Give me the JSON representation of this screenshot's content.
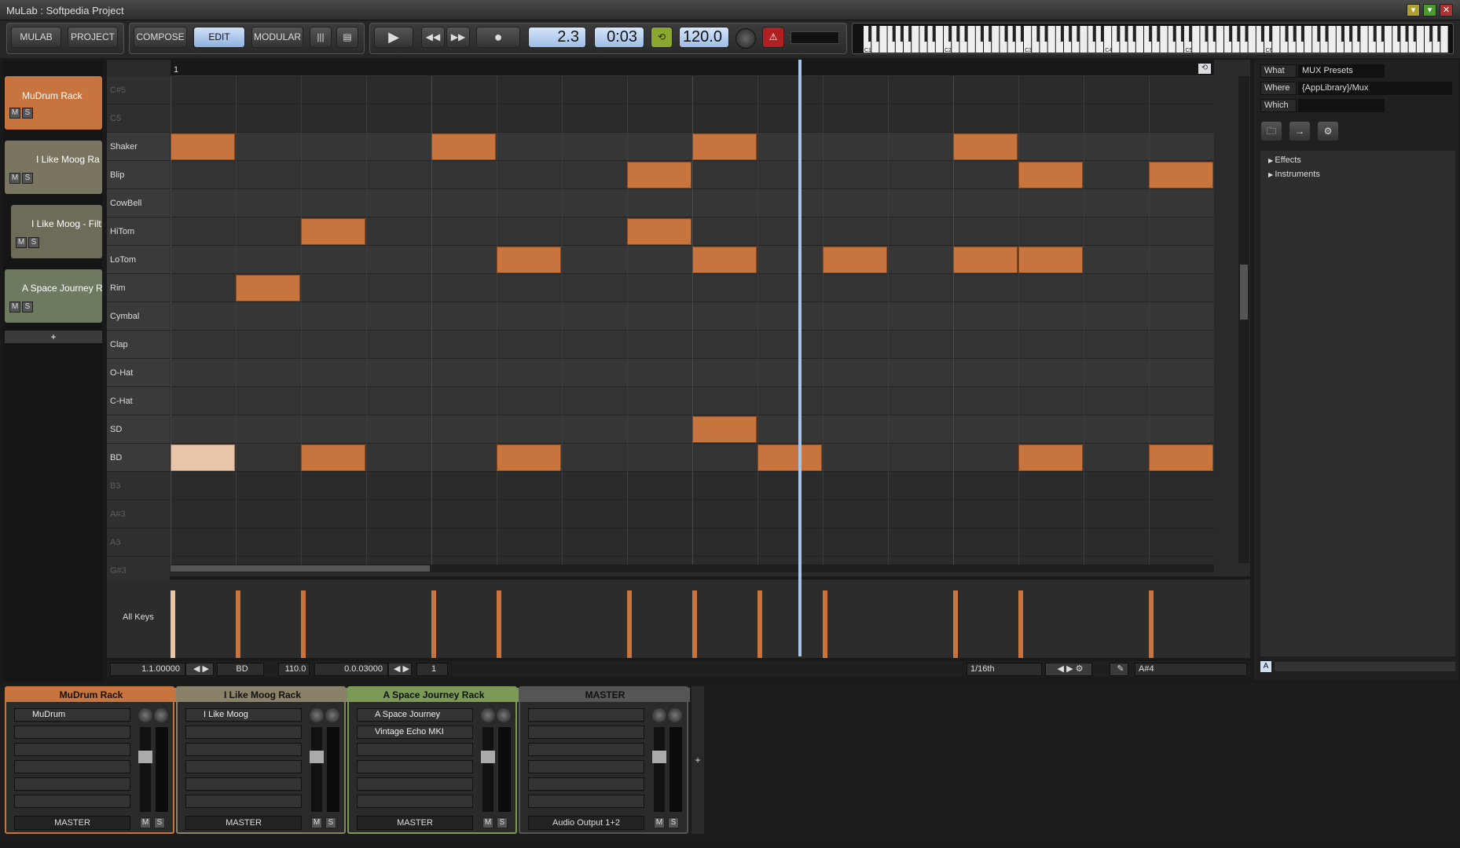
{
  "window": {
    "title": "MuLab : Softpedia Project"
  },
  "toolbar": {
    "mulab": "MULAB",
    "project": "PROJECT",
    "compose": "COMPOSE",
    "edit": "EDIT",
    "modular": "MODULAR",
    "position": "2.3",
    "time": "0:03",
    "tempo": "120.0"
  },
  "keyboard": {
    "octaves": [
      "C1",
      "C2",
      "C3",
      "C4",
      "C5",
      "C6"
    ]
  },
  "tracks": [
    {
      "name": "MuDrum Rack",
      "color": "#c8743e"
    },
    {
      "name": "I Like Moog Ra",
      "color": "#7a7560"
    },
    {
      "name": "I Like Moog - Filt",
      "color": "#6e6b58"
    },
    {
      "name": "A Space Journey R",
      "color": "#6e7a60"
    }
  ],
  "track_add": "+",
  "editor": {
    "ruler_start": "1",
    "keys": [
      {
        "name": "C#5",
        "dim": true
      },
      {
        "name": "C5",
        "dim": true
      },
      {
        "name": "Shaker",
        "dim": false
      },
      {
        "name": "Blip",
        "dim": false
      },
      {
        "name": "CowBell",
        "dim": false
      },
      {
        "name": "HiTom",
        "dim": false
      },
      {
        "name": "LoTom",
        "dim": false
      },
      {
        "name": "Rim",
        "dim": false
      },
      {
        "name": "Cymbal",
        "dim": false
      },
      {
        "name": "Clap",
        "dim": false
      },
      {
        "name": "O-Hat",
        "dim": false
      },
      {
        "name": "C-Hat",
        "dim": false
      },
      {
        "name": "SD",
        "dim": false
      },
      {
        "name": "BD",
        "dim": false
      },
      {
        "name": "B3",
        "dim": true
      },
      {
        "name": "A#3",
        "dim": true
      },
      {
        "name": "A3",
        "dim": true
      },
      {
        "name": "G#3",
        "dim": true
      }
    ],
    "notes": [
      {
        "key": 2,
        "step": 0
      },
      {
        "key": 2,
        "step": 4
      },
      {
        "key": 2,
        "step": 8
      },
      {
        "key": 2,
        "step": 12
      },
      {
        "key": 3,
        "step": 7
      },
      {
        "key": 3,
        "step": 13
      },
      {
        "key": 3,
        "step": 15
      },
      {
        "key": 5,
        "step": 2
      },
      {
        "key": 5,
        "step": 7
      },
      {
        "key": 6,
        "step": 5
      },
      {
        "key": 6,
        "step": 8
      },
      {
        "key": 6,
        "step": 10
      },
      {
        "key": 6,
        "step": 12
      },
      {
        "key": 6,
        "step": 13
      },
      {
        "key": 7,
        "step": 1
      },
      {
        "key": 12,
        "step": 8
      },
      {
        "key": 13,
        "step": 0,
        "selected": true
      },
      {
        "key": 13,
        "step": 2
      },
      {
        "key": 13,
        "step": 5
      },
      {
        "key": 13,
        "step": 9
      },
      {
        "key": 13,
        "step": 13
      },
      {
        "key": 13,
        "step": 15
      }
    ],
    "velocity_label": "All Keys",
    "velocity_steps": [
      0,
      1,
      2,
      4,
      5,
      7,
      8,
      9,
      10,
      12,
      13,
      15
    ]
  },
  "status": {
    "pos": "1.1.00000",
    "key": "BD",
    "vel": "110.0",
    "len": "0.0.03000",
    "count": "1",
    "quant": "1/16th",
    "note": "A#4"
  },
  "browser": {
    "what_label": "What",
    "what": "MUX Presets",
    "where_label": "Where",
    "where": "{AppLibrary}/Mux",
    "which_label": "Which",
    "tree": [
      "Effects",
      "Instruments"
    ],
    "footer": "A"
  },
  "mixer": [
    {
      "name": "MuDrum Rack",
      "color": "#c8743e",
      "slots": [
        "MuDrum",
        "",
        "",
        "",
        "",
        ""
      ],
      "out": "MASTER"
    },
    {
      "name": "I Like Moog Rack",
      "color": "#8a8268",
      "slots": [
        "I Like Moog",
        "",
        "",
        "",
        "",
        ""
      ],
      "out": "MASTER"
    },
    {
      "name": "A Space Journey Rack",
      "color": "#7a9a55",
      "slots": [
        "A Space Journey",
        "Vintage Echo MKI",
        "",
        "",
        "",
        ""
      ],
      "out": "MASTER"
    },
    {
      "name": "MASTER",
      "color": "#555555",
      "slots": [
        "",
        "",
        "",
        "",
        "",
        ""
      ],
      "out": "Audio Output 1+2"
    }
  ],
  "mixer_add": "+",
  "ms": {
    "m": "M",
    "s": "S"
  }
}
